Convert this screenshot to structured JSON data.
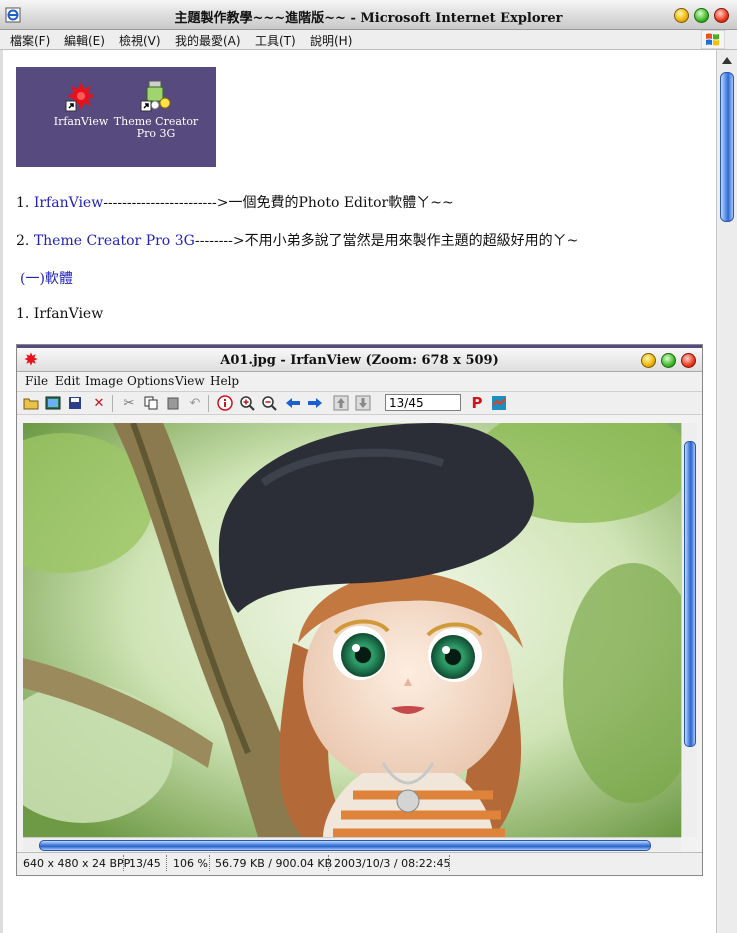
{
  "browser": {
    "title": "主題製作教學~~~進階版~~ - Microsoft Internet Explorer",
    "menu": [
      "檔案(F)",
      "編輯(E)",
      "檢視(V)",
      "我的最愛(A)",
      "工具(T)",
      "說明(H)"
    ]
  },
  "desktop_icons": [
    {
      "label": "IrfanView",
      "icon": "irfanview-icon"
    },
    {
      "label": "Theme Creator Pro 3G",
      "icon": "theme-creator-icon"
    }
  ],
  "article": {
    "item1_num": "1.",
    "item1_link": "IrfanView",
    "item1_text": "------------------------>一個免費的Photo Editor軟體ㄚ~~",
    "item2_num": "2.",
    "item2_link": "Theme Creator Pro 3G",
    "item2_text": "-------->不用小弟多說了當然是用來製作主題的超級好用的ㄚ~",
    "section_link": "(一)軟體",
    "sub_heading": "1. IrfanView"
  },
  "irfanview": {
    "title": "A01.jpg - IrfanView (Zoom: 678 x 509)",
    "menu": [
      "File",
      "Edit",
      "Image",
      "Options",
      "View",
      "Help"
    ],
    "page_field": "13/45",
    "status": [
      "640 x 480 x 24 BPP",
      "13/45",
      "106 %",
      "56.79 KB / 900.04 KB",
      "2003/10/3 / 08:22:45"
    ]
  },
  "colors": {
    "link": "#2222b8",
    "icon_panel": "#574a7e",
    "scroll_thumb": "#2f6ad0"
  }
}
